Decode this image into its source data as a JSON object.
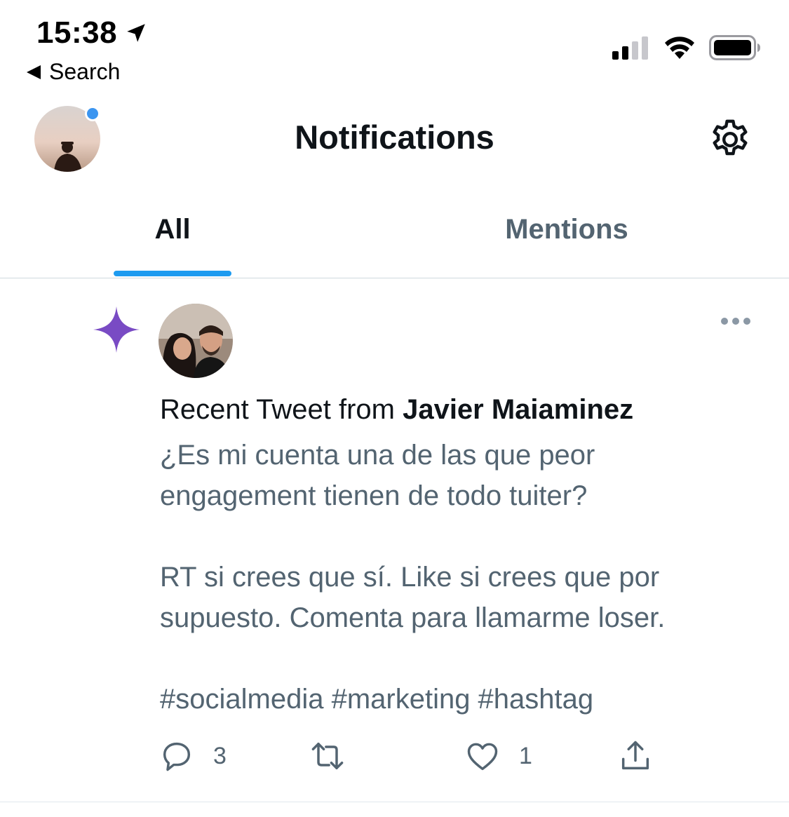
{
  "status_bar": {
    "time": "15:38",
    "back_label": "Search"
  },
  "header": {
    "title": "Notifications"
  },
  "tabs": [
    {
      "label": "All",
      "selected": true
    },
    {
      "label": "Mentions",
      "selected": false
    }
  ],
  "notification": {
    "heading_prefix": "Recent Tweet from ",
    "author_name": "Javier Maiaminez",
    "tweet_lines": [
      "¿Es mi cuenta una de las que peor",
      "engagement tienen de todo tuiter?",
      "RT si crees que sí. Like si crees que por",
      "supuesto. Comenta para llamarme loser.",
      "#socialmedia #marketing #hashtag"
    ],
    "reply_count": "3",
    "like_count": "1"
  },
  "icons": {
    "location": "location-arrow-icon",
    "settings": "gear-icon",
    "sparkle": "sparkle-icon",
    "more": "more-dots-icon",
    "reply": "reply-icon",
    "retweet": "retweet-icon",
    "like": "heart-icon",
    "share": "share-icon"
  },
  "colors": {
    "accent": "#1d9bf0",
    "sparkle": "#794bc4",
    "secondary_text": "#536471",
    "online_dot": "#3b95f0"
  }
}
